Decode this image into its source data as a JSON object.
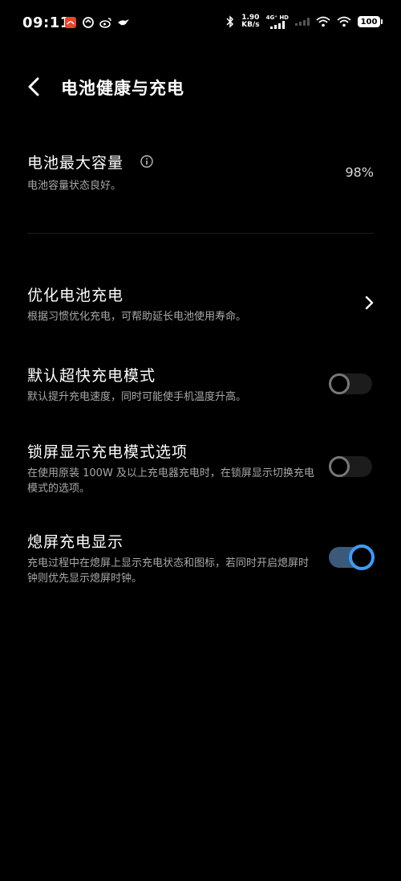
{
  "status_bar": {
    "time": "09:11",
    "net_speed_value": "1.90",
    "net_speed_unit": "KB/s",
    "net_type": "4G⁺ HD",
    "battery_level": "100"
  },
  "header": {
    "title": "电池健康与充电"
  },
  "battery_capacity": {
    "title": "电池最大容量",
    "subtitle": "电池容量状态良好。",
    "value": "98%"
  },
  "optimize_charging": {
    "title": "优化电池充电",
    "subtitle": "根据习惯优化充电，可帮助延长电池使用寿命。"
  },
  "default_fast_charge": {
    "title": "默认超快充电模式",
    "subtitle": "默认提升充电速度，同时可能使手机温度升高。",
    "enabled": false
  },
  "lockscreen_charge_mode": {
    "title": "锁屏显示充电模式选项",
    "subtitle": "在使用原装 100W 及以上充电器充电时，在锁屏显示切换充电模式的选项。",
    "enabled": false
  },
  "aod_charging_display": {
    "title": "熄屏充电显示",
    "subtitle": "充电过程中在熄屏上显示充电状态和图标，若同时开启熄屏时钟则优先显示熄屏时钟。",
    "enabled": true
  },
  "colors": {
    "background": "#000000",
    "accent": "#3d9bf3",
    "secondary_text": "#a8a8a8"
  }
}
